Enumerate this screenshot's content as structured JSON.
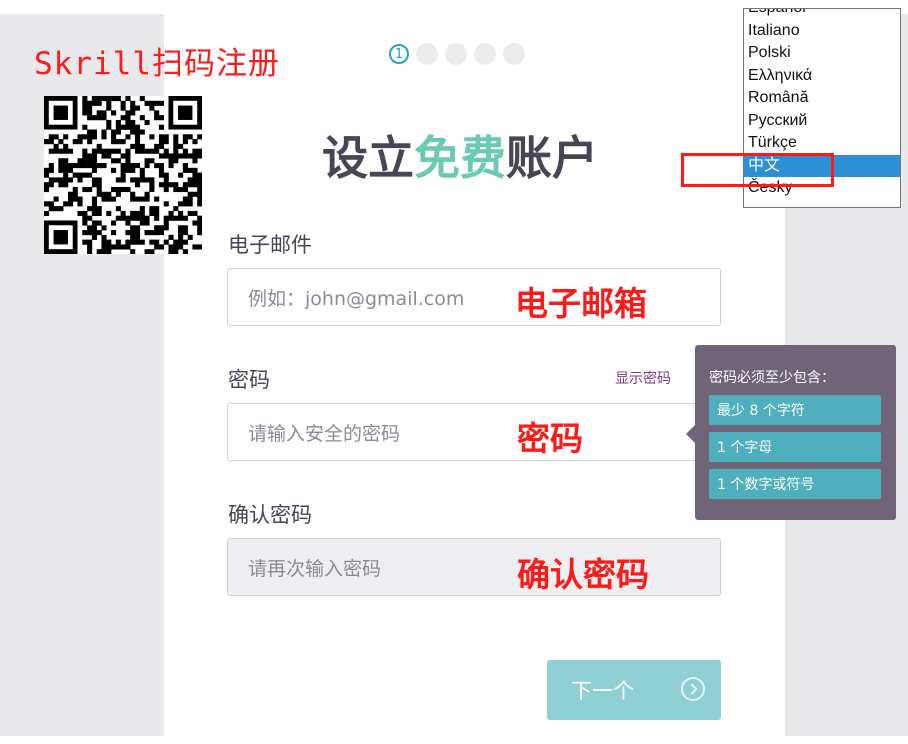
{
  "promo": {
    "title": "Skrill扫码注册",
    "qr_label": "QR code"
  },
  "steps": {
    "current": "1",
    "total": 5
  },
  "heading": {
    "part1": "设立",
    "accent": "免费",
    "part2": "账户",
    "accent_color": "#6cc9b2"
  },
  "email": {
    "label": "电子邮件",
    "placeholder": "例如：john@gmail.com",
    "annotation": "电子邮箱"
  },
  "password": {
    "label": "密码",
    "show_label": "显示密码",
    "placeholder": "请输入安全的密码",
    "annotation": "密码"
  },
  "confirm": {
    "label": "确认密码",
    "placeholder": "请再次输入密码",
    "annotation": "确认密码"
  },
  "next_button": {
    "label": "下一个"
  },
  "languages": {
    "items": [
      "Español",
      "Italiano",
      "Polski",
      "Ελληνικά",
      "Română",
      "Русский",
      "Türkçe",
      "中文",
      "Česky"
    ],
    "selected": "中文"
  },
  "password_tip": {
    "title": "密码必须至少包含：",
    "rules": [
      "最少 8 个字符",
      "1 个字母",
      "1 个数字或符号"
    ]
  },
  "colors": {
    "annotation": "#ff1a1a",
    "brand_teal": "#2aa3b5",
    "tooltip_bg": "#6f6577",
    "rule_bg": "#4fb0bd"
  }
}
